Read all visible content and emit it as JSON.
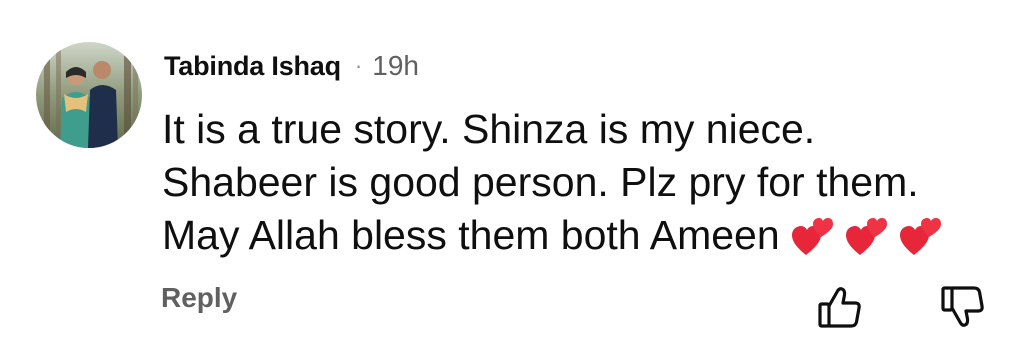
{
  "comment": {
    "author": "Tabinda Ishaq",
    "separator": "·",
    "time": "19h",
    "lines": [
      "It is a true story. Shinza is my niece.",
      "Shabeer is good person. Plz pry for them.",
      "May Allah bless them both Ameen"
    ],
    "emoji": "heart-emoji",
    "reply_label": "Reply",
    "icons": {
      "like": "thumbs-up-icon",
      "dislike": "thumbs-down-icon",
      "avatar": "avatar"
    },
    "colors": {
      "text": "#0f0f0f",
      "secondary": "#606060",
      "heart": "#e8263a"
    }
  }
}
